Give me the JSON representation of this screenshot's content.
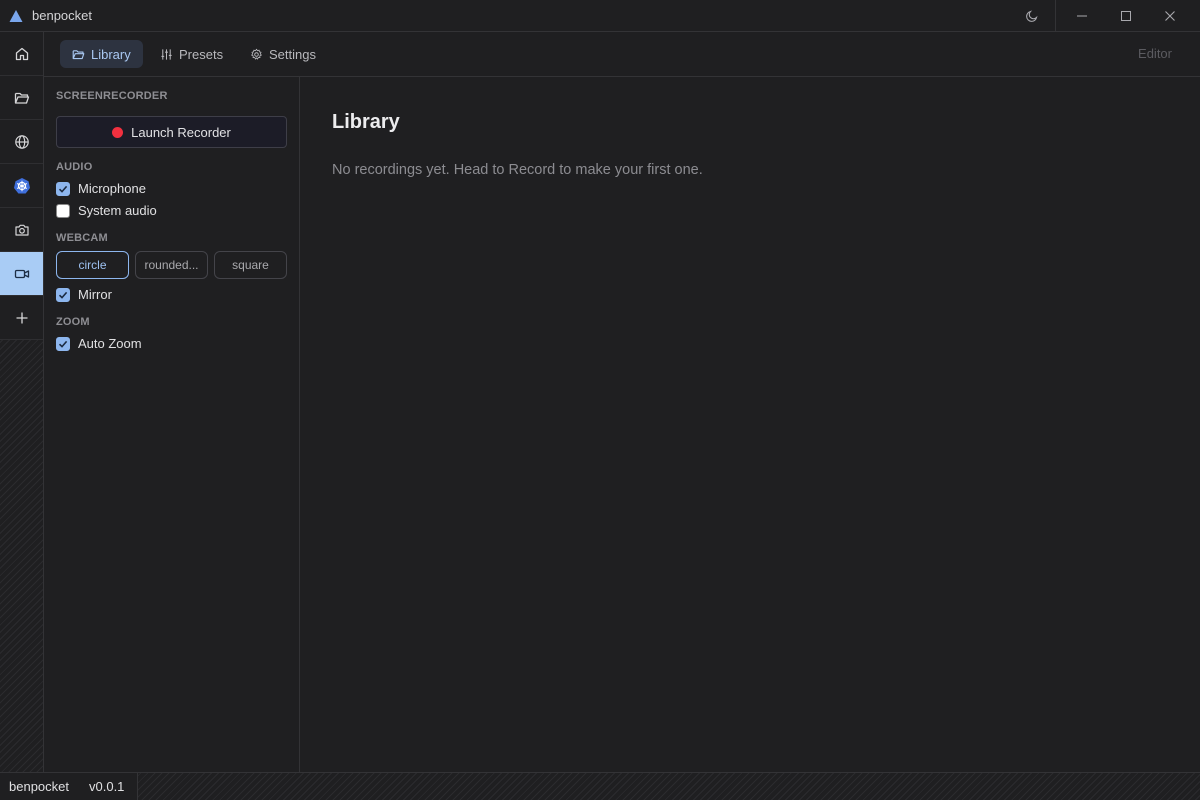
{
  "app": {
    "title": "benpocket"
  },
  "tabs": [
    {
      "label": "Library",
      "icon": "folder-open-icon"
    },
    {
      "label": "Presets",
      "icon": "sliders-icon"
    },
    {
      "label": "Settings",
      "icon": "gear-icon"
    }
  ],
  "editor_label": "Editor",
  "rail": [
    "home-icon",
    "folder-icon",
    "globe-icon",
    "kubernetes-icon",
    "camera-icon",
    "video-camera-icon",
    "plus-icon"
  ],
  "panel": {
    "section_screenrecorder": "SCREENRECORDER",
    "launch_label": "Launch Recorder",
    "section_audio": "AUDIO",
    "microphone_label": "Microphone",
    "microphone_checked": true,
    "system_audio_label": "System audio",
    "system_audio_checked": false,
    "section_webcam": "WEBCAM",
    "shapes": [
      "circle",
      "rounded...",
      "square"
    ],
    "selected_shape": "circle",
    "mirror_label": "Mirror",
    "mirror_checked": true,
    "section_zoom": "ZOOM",
    "auto_zoom_label": "Auto Zoom",
    "auto_zoom_checked": true
  },
  "main": {
    "title": "Library",
    "empty_message": "No recordings yet. Head to Record to make your first one."
  },
  "status": {
    "app_name": "benpocket",
    "version": "v0.0.1"
  },
  "colors": {
    "accent": "#8db6ee",
    "record": "#f2303f",
    "background": "#1f1f21"
  }
}
